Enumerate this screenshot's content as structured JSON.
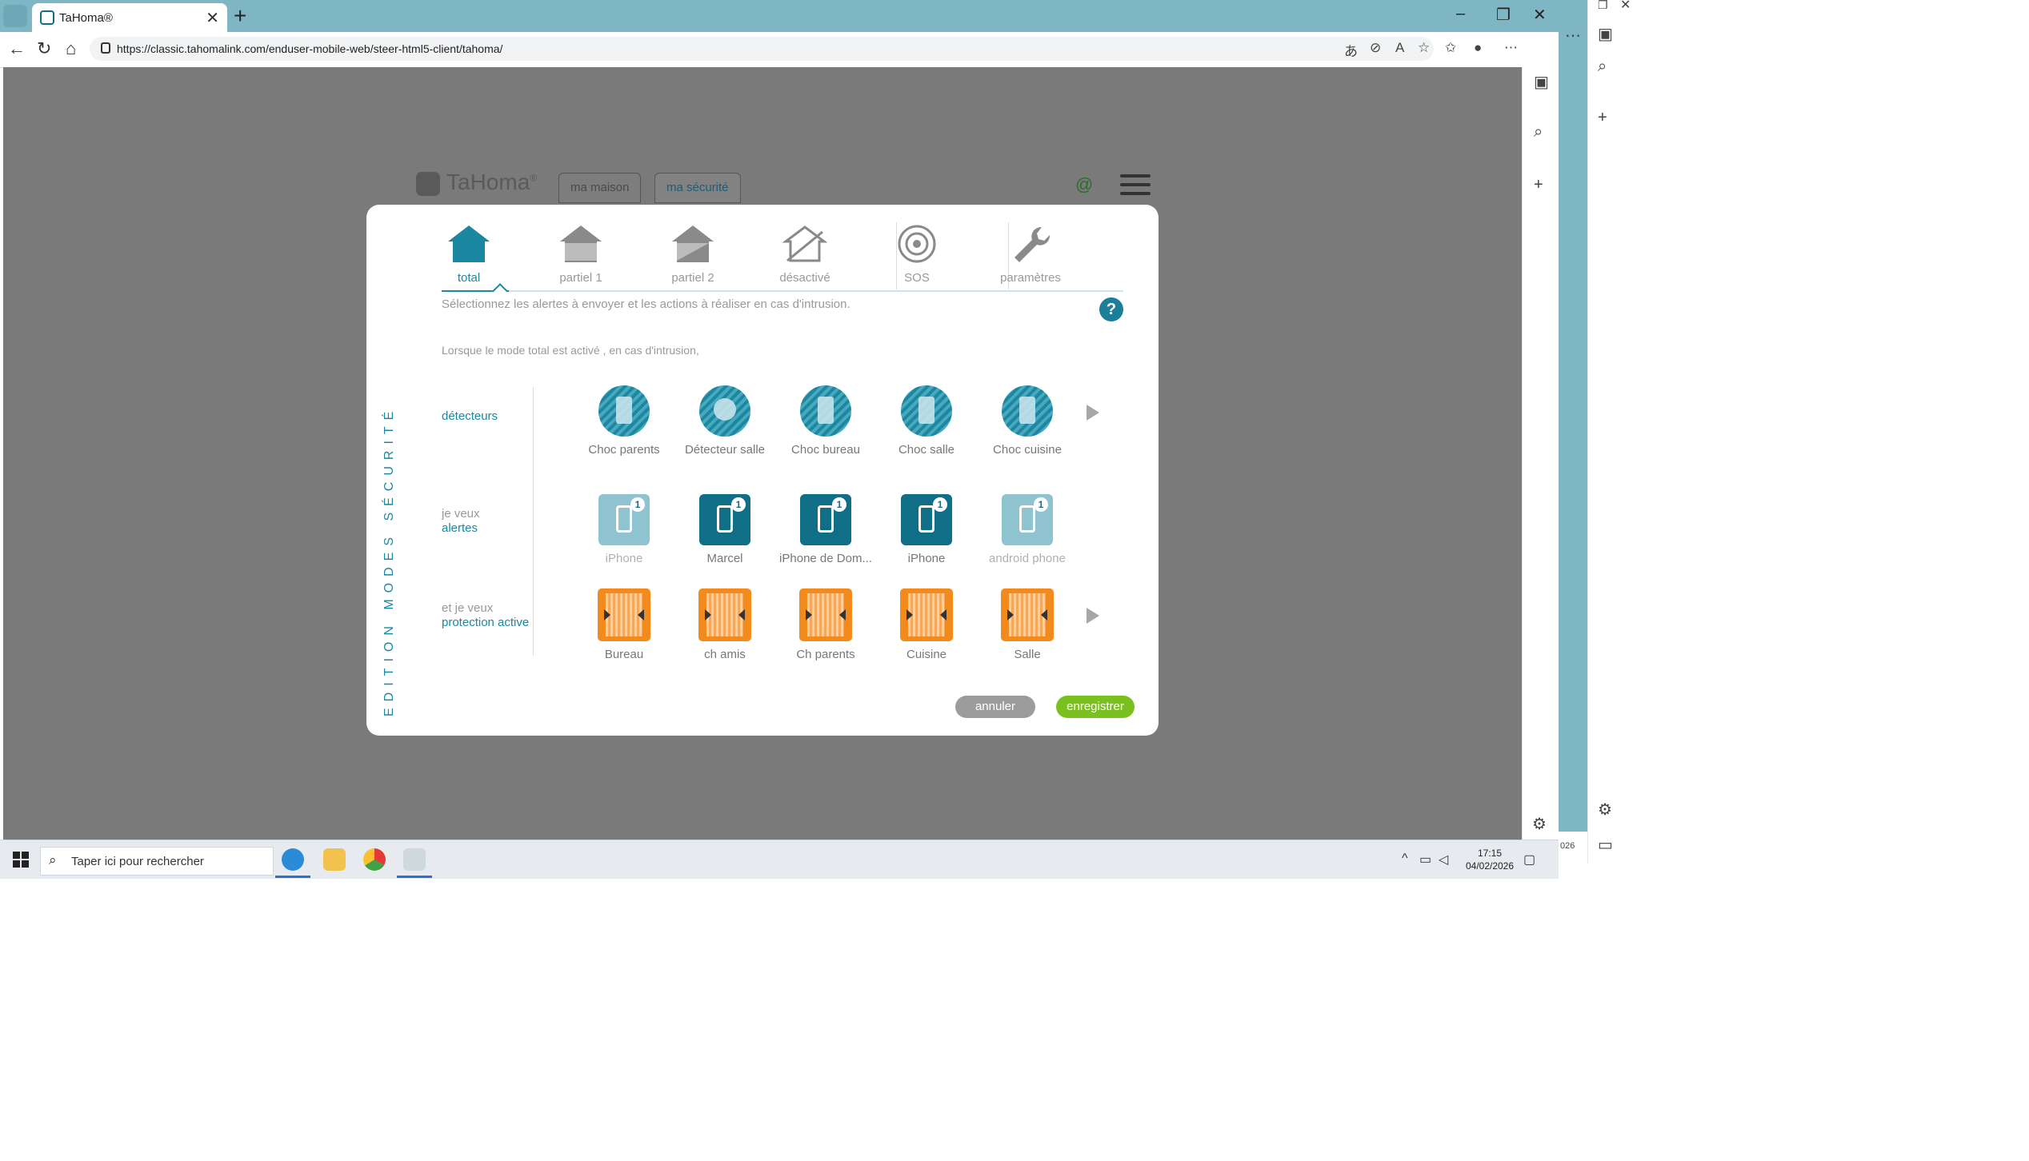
{
  "browser": {
    "tab_title": "TaHoma®",
    "url": "https://classic.tahomalink.com/enduser-mobile-web/steer-html5-client/tahoma/",
    "new_tab_symbol": "+",
    "close_symbol": "✕",
    "minimize_symbol": "–",
    "restore_symbol": "❐"
  },
  "app": {
    "brand": "TaHoma",
    "brand_mark": "®",
    "nav": [
      {
        "label": "ma maison"
      },
      {
        "label": "ma sécurité"
      }
    ]
  },
  "modal": {
    "vertical_title": "EDITION MODES SÉCURITÉ",
    "modes": [
      {
        "label": "total",
        "active": true
      },
      {
        "label": "partiel 1"
      },
      {
        "label": "partiel 2"
      },
      {
        "label": "désactivé"
      },
      {
        "label": "SOS"
      },
      {
        "label": "paramètres"
      }
    ],
    "instruction": "Sélectionnez les alertes à envoyer et les actions à réaliser en cas d'intrusion.",
    "help_label": "?",
    "sub_instruction": "Lorsque le mode total est activé , en cas d'intrusion,",
    "rows": {
      "detectors": {
        "label": "détecteurs"
      },
      "alerts": {
        "label_line1": "je veux",
        "label_line2": "alertes"
      },
      "protection": {
        "label_line1": "et je veux",
        "label_line2": "protection active"
      }
    },
    "detectors": [
      {
        "name": "Choc parents",
        "kind": "door"
      },
      {
        "name": "Détecteur salle",
        "kind": "person"
      },
      {
        "name": "Choc bureau",
        "kind": "door"
      },
      {
        "name": "Choc salle",
        "kind": "door"
      },
      {
        "name": "Choc cuisine",
        "kind": "door"
      }
    ],
    "alerts": [
      {
        "name": "iPhone",
        "selected": false,
        "badge": "1"
      },
      {
        "name": "Marcel",
        "selected": true,
        "badge": "1"
      },
      {
        "name": "iPhone de Dom...",
        "selected": true,
        "badge": "1"
      },
      {
        "name": "iPhone",
        "selected": true,
        "badge": "1"
      },
      {
        "name": "android phone",
        "selected": false,
        "badge": "1"
      }
    ],
    "protection": [
      {
        "name": "Bureau"
      },
      {
        "name": "ch amis"
      },
      {
        "name": "Ch parents"
      },
      {
        "name": "Cuisine"
      },
      {
        "name": "Salle"
      }
    ],
    "buttons": {
      "cancel": "annuler",
      "save": "enregistrer"
    }
  },
  "taskbar": {
    "search_placeholder": "Taper ici pour rechercher",
    "time": "17:15",
    "date": "04/02/2026",
    "overflow_text": "026"
  },
  "colors": {
    "accent": "#1b87a0",
    "save": "#7ac01e",
    "shutter": "#f28a1c",
    "overlay": "#7a7a7a"
  }
}
